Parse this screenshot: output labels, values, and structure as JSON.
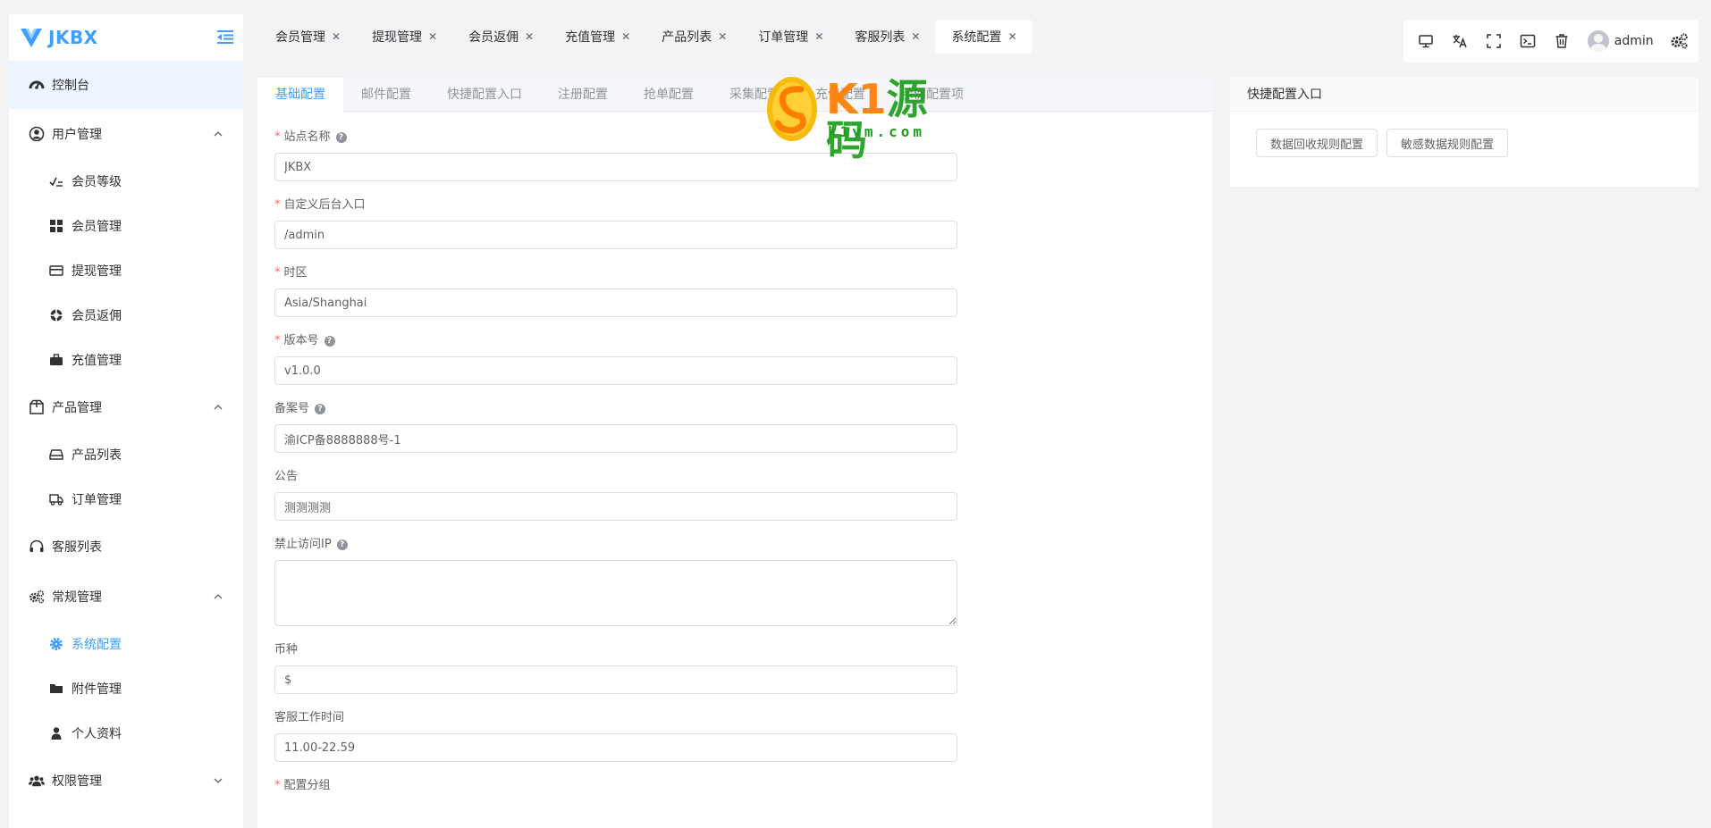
{
  "brand": {
    "name": "JKBX"
  },
  "sidebar": {
    "dashboard": "控制台",
    "groups": [
      {
        "label": "用户管理",
        "items": [
          "会员等级",
          "会员管理",
          "提现管理",
          "会员返佣",
          "充值管理"
        ]
      },
      {
        "label": "产品管理",
        "items": [
          "产品列表",
          "订单管理"
        ]
      },
      {
        "label": "客服列表",
        "items": []
      },
      {
        "label": "常规管理",
        "items": [
          "系统配置",
          "附件管理",
          "个人资料"
        ]
      },
      {
        "label": "权限管理",
        "items": []
      }
    ]
  },
  "page_tabs": [
    "会员管理",
    "提现管理",
    "会员返佣",
    "充值管理",
    "产品列表",
    "订单管理",
    "客服列表",
    "系统配置"
  ],
  "toolbar": {
    "username": "admin"
  },
  "config_tabs": [
    "基础配置",
    "邮件配置",
    "快捷配置入口",
    "注册配置",
    "抢单配置",
    "采集配置",
    "充值配置",
    "示例配置项"
  ],
  "form": {
    "site_name": {
      "label": "站点名称",
      "value": "JKBX"
    },
    "admin_entry": {
      "label": "自定义后台入口",
      "value": "/admin"
    },
    "timezone": {
      "label": "时区",
      "value": "Asia/Shanghai"
    },
    "version": {
      "label": "版本号",
      "value": "v1.0.0"
    },
    "beian": {
      "label": "备案号",
      "value": "渝ICP备8888888号-1"
    },
    "notice": {
      "label": "公告",
      "value": "测测测测"
    },
    "ban_ip": {
      "label": "禁止访问IP",
      "value": ""
    },
    "currency": {
      "label": "币种",
      "value": "$"
    },
    "service_time": {
      "label": "客服工作时间",
      "value": "11.00-22.59"
    },
    "config_group": {
      "label": "配置分组"
    }
  },
  "quick": {
    "title": "快捷配置入口",
    "buttons": [
      "数据回收规则配置",
      "敏感数据规则配置"
    ]
  },
  "watermark": {
    "text_a": "K1",
    "text_b": "源码",
    "url": "k1ym.com"
  },
  "colors": {
    "primary": "#409eff",
    "required": "#f56c6c",
    "bg": "#f2f3f5"
  }
}
